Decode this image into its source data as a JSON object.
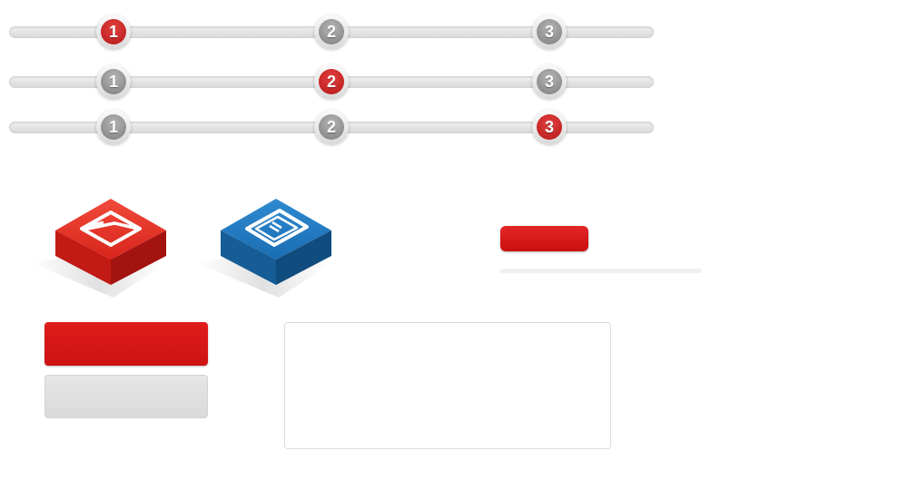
{
  "steppers": [
    {
      "steps": [
        {
          "label": "1",
          "active": true
        },
        {
          "label": "2",
          "active": false
        },
        {
          "label": "3",
          "active": false
        }
      ]
    },
    {
      "steps": [
        {
          "label": "1",
          "active": false
        },
        {
          "label": "2",
          "active": true
        },
        {
          "label": "3",
          "active": false
        }
      ]
    },
    {
      "steps": [
        {
          "label": "1",
          "active": false
        },
        {
          "label": "2",
          "active": false
        },
        {
          "label": "3",
          "active": true
        }
      ]
    }
  ],
  "tiles": [
    {
      "icon": "envelope-icon",
      "color": "#d81c1c"
    },
    {
      "icon": "mobile-phone-icon",
      "color": "#1b6fb5"
    }
  ],
  "colors": {
    "accent_red": "#d81414",
    "inactive_gray": "#8c8c8c",
    "tile_blue": "#1b6fb5"
  }
}
